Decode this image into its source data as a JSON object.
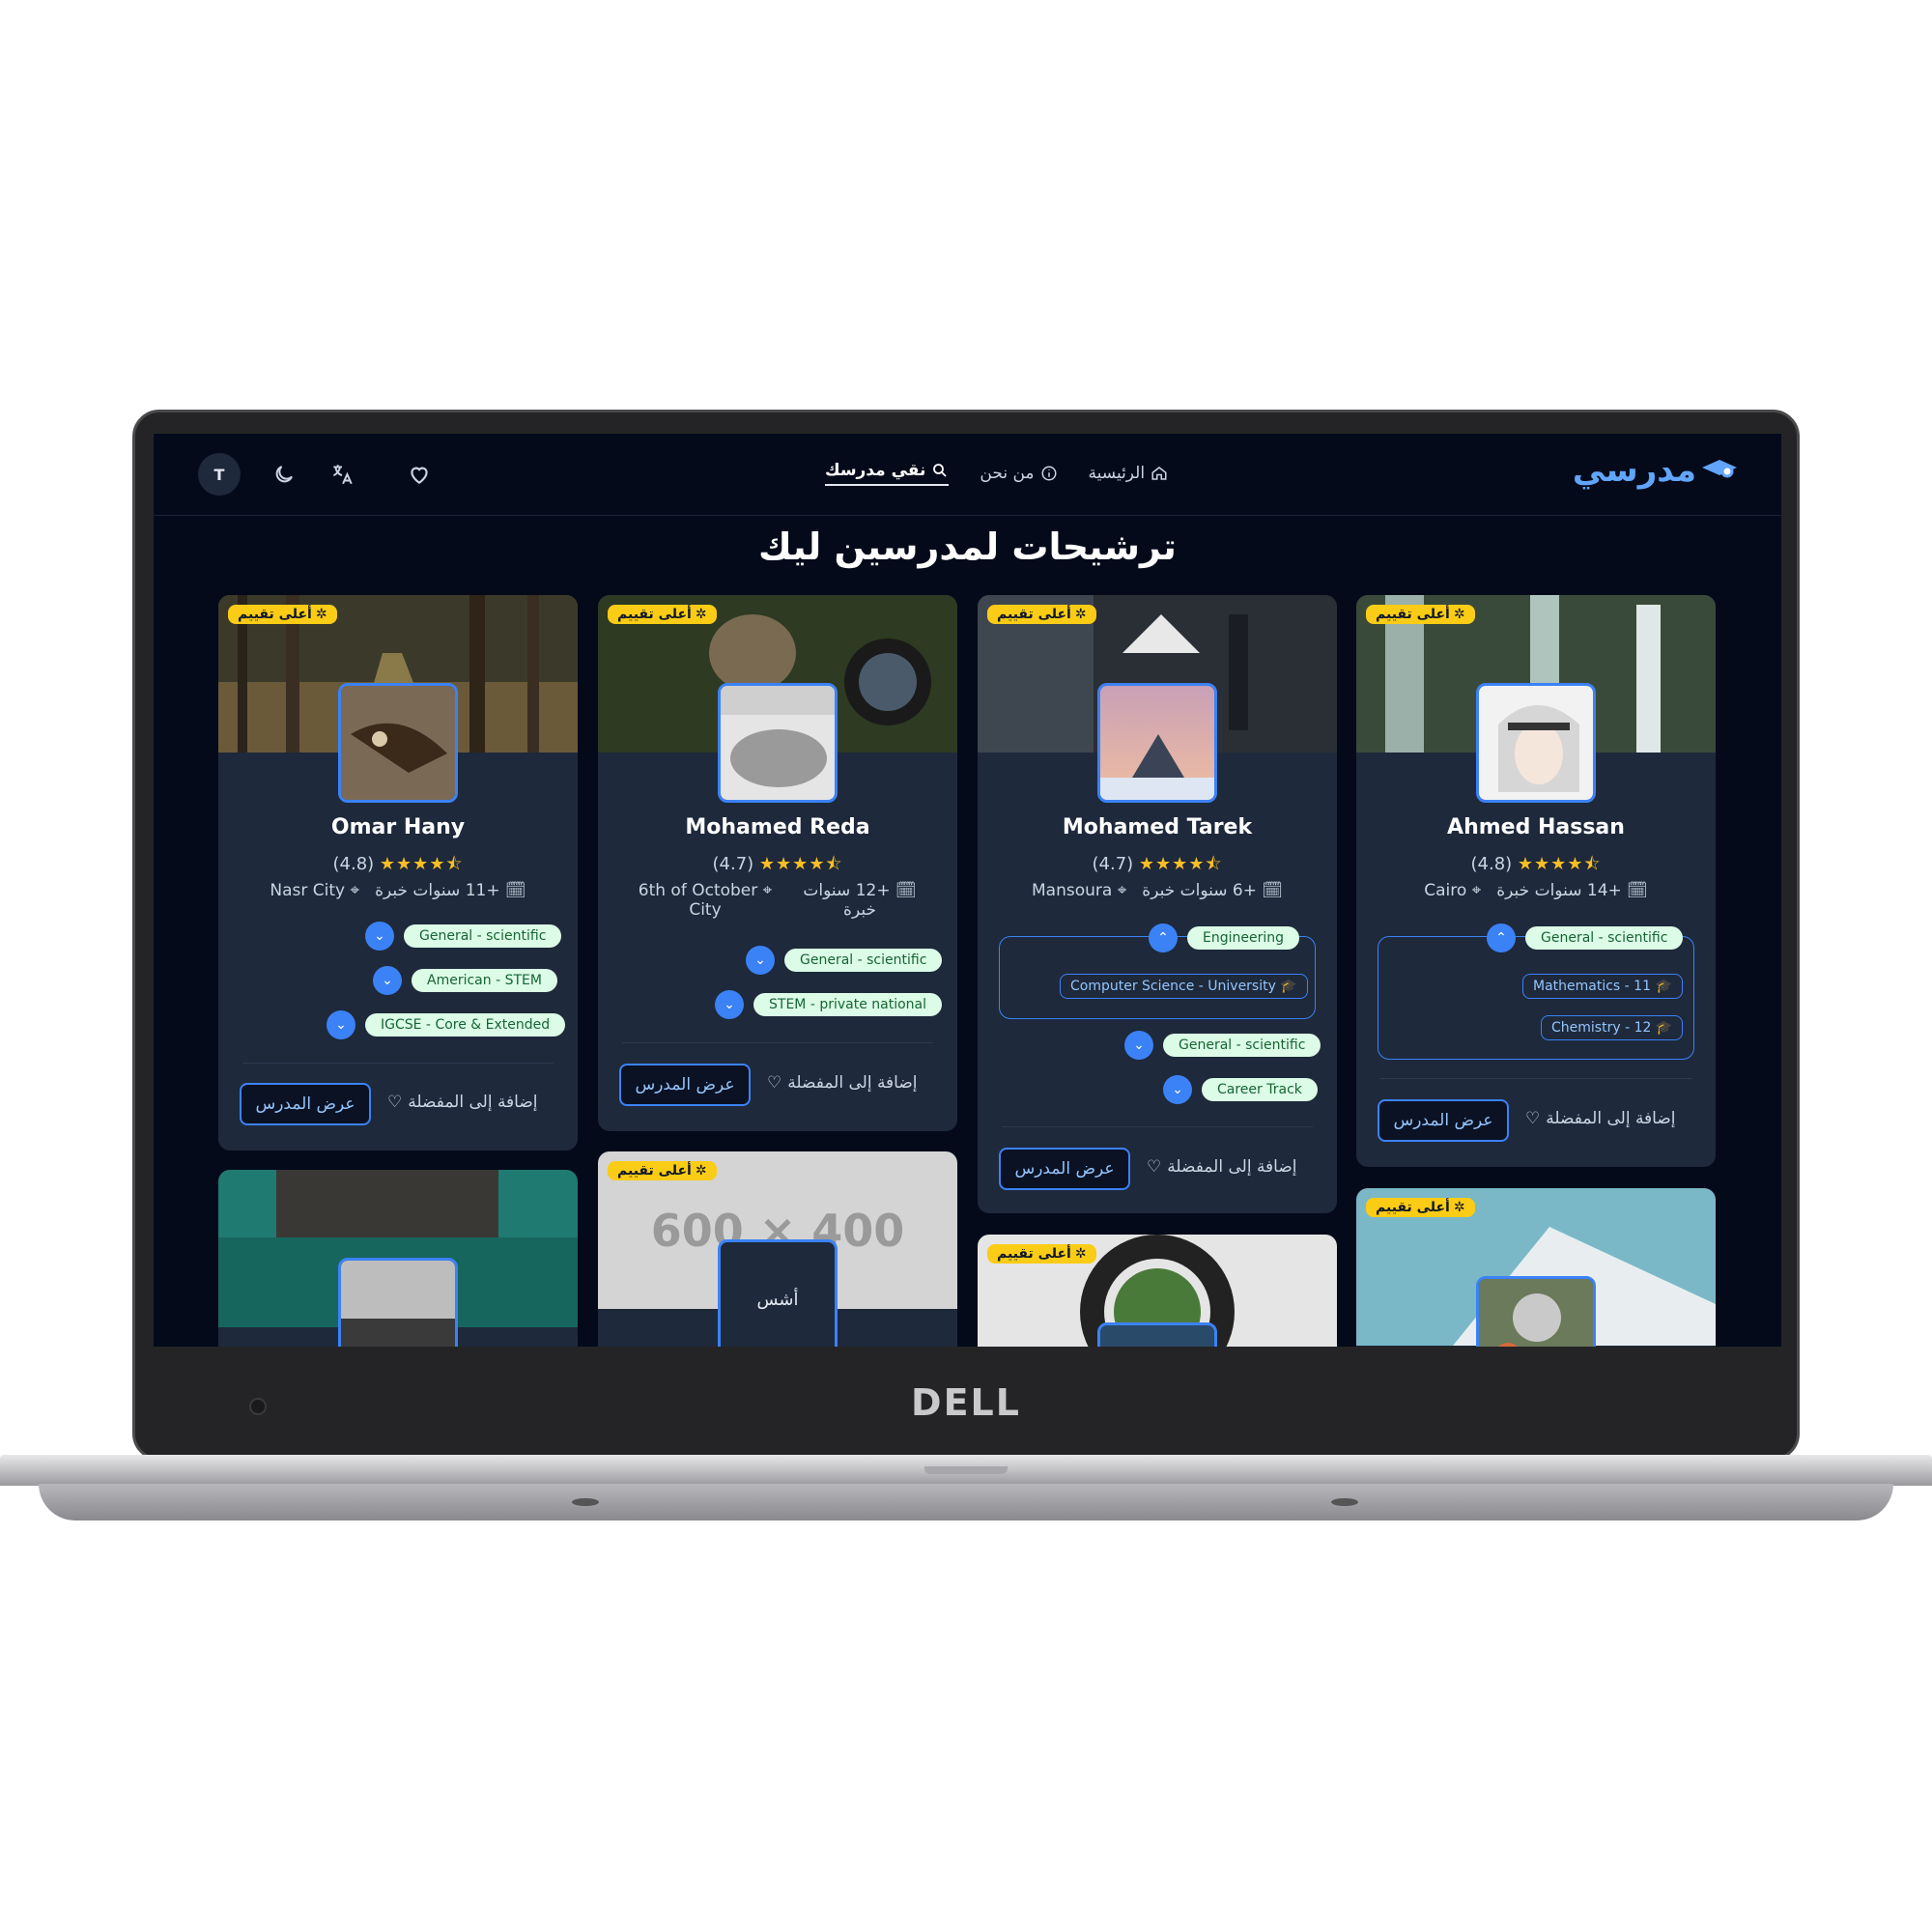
{
  "device": {
    "brand": "DELL"
  },
  "navbar": {
    "logo_text": "مدرسي",
    "links": [
      {
        "label": "الرئيسية",
        "icon": "home-icon"
      },
      {
        "label": "من نحن",
        "icon": "info-icon"
      },
      {
        "label": "نقي مدرسك",
        "icon": "search-icon",
        "active": true
      }
    ],
    "avatar_initial": "T",
    "icons": [
      "moon-icon",
      "translate-icon",
      "heart-icon"
    ]
  },
  "page": {
    "title": "ترشيحات لمدرسين ليك"
  },
  "badge_label": "أعلى تقييم",
  "actions": {
    "view_label": "عرض المدرس",
    "fav_label": "إضافة إلى المفضلة"
  },
  "teachers": [
    {
      "name": "Omar Hany",
      "rating": "(4.8)",
      "location": "Nasr City",
      "experience": "+11 سنوات خبرة",
      "tags": [
        "General - scientific",
        "American - STEM",
        "IGCSE - Core & Extended"
      ]
    },
    {
      "name": "Mohamed Reda",
      "rating": "(4.7)",
      "location": "6th of October City",
      "experience": "+12 سنوات خبرة",
      "tags": [
        "General - scientific",
        "STEM - private national"
      ]
    },
    {
      "name": "Mohamed Tarek",
      "rating": "(4.7)",
      "location": "Mansoura",
      "experience": "+6 سنوات خبرة",
      "tags": [
        "Engineering",
        "General - scientific",
        "Career Track"
      ],
      "subjects": [
        "Computer Science - University"
      ]
    },
    {
      "name": "Ahmed Hassan",
      "rating": "(4.8)",
      "location": "Cairo",
      "experience": "+14 سنوات خبرة",
      "tags": [
        "General - scientific"
      ],
      "subjects": [
        "Mathematics - 11",
        "Chemistry - 12"
      ]
    }
  ],
  "placeholder": {
    "image_text": "600 × 400",
    "photo_text": "أشس"
  },
  "stars": "★★★★⯪",
  "colors": {
    "accent": "#3b82f6",
    "badge": "#facc15",
    "card": "#1e293b",
    "background": "#040a1a",
    "tag": "#dcfce7"
  }
}
